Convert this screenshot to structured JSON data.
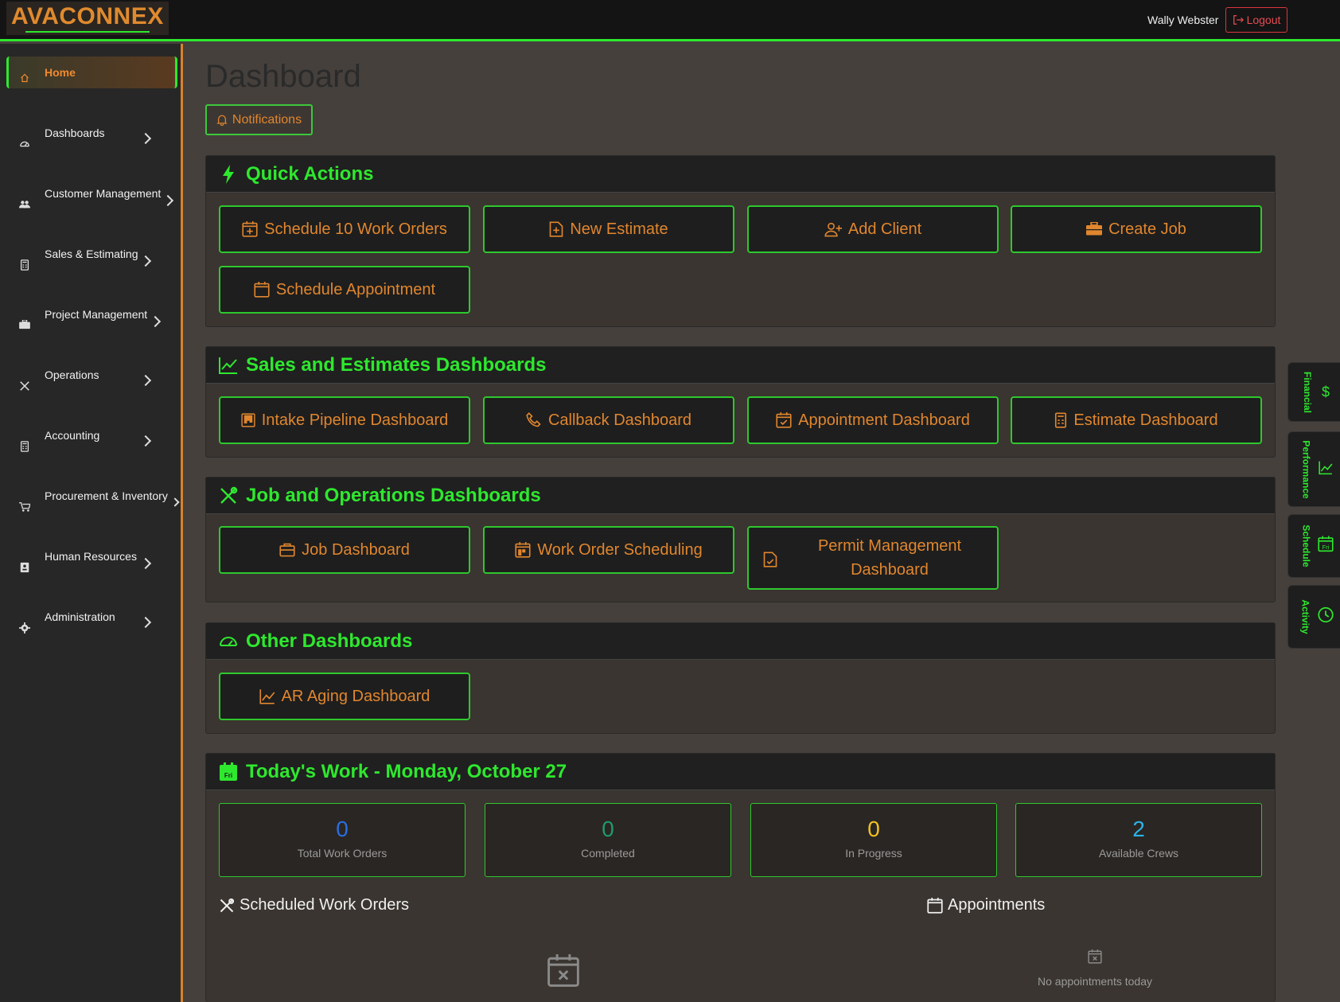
{
  "header": {
    "brand": "AVACONNEX",
    "user_name": "Wally Webster",
    "logout_label": "Logout"
  },
  "sidebar": {
    "items": [
      {
        "label": "Home",
        "icon": "home-icon",
        "active": true
      },
      {
        "label": "Dashboards",
        "icon": "gauge-icon"
      },
      {
        "label": "Customer Management",
        "icon": "people-icon"
      },
      {
        "label": "Sales & Estimating",
        "icon": "calculator-icon"
      },
      {
        "label": "Project Management",
        "icon": "briefcase-icon"
      },
      {
        "label": "Operations",
        "icon": "tools-icon"
      },
      {
        "label": "Accounting",
        "icon": "calculator-icon"
      },
      {
        "label": "Procurement & Inventory",
        "icon": "cart-icon"
      },
      {
        "label": "Human Resources",
        "icon": "badge-icon"
      },
      {
        "label": "Administration",
        "icon": "gear-icon"
      }
    ]
  },
  "main": {
    "title": "Dashboard",
    "notifications_label": "Notifications",
    "quick_actions": {
      "title": "Quick Actions",
      "buttons": [
        "Schedule 10 Work Orders",
        "New Estimate",
        "Add Client",
        "Create Job",
        "Schedule Appointment"
      ]
    },
    "sales_dashboards": {
      "title": "Sales and Estimates Dashboards",
      "buttons": [
        "Intake Pipeline Dashboard",
        "Callback Dashboard",
        "Appointment Dashboard",
        "Estimate Dashboard"
      ]
    },
    "job_dashboards": {
      "title": "Job and Operations Dashboards",
      "buttons": [
        "Job Dashboard",
        "Work Order Scheduling",
        "Permit Management Dashboard"
      ]
    },
    "other_dashboards": {
      "title": "Other Dashboards",
      "buttons": [
        "AR Aging Dashboard"
      ]
    },
    "todays_work": {
      "title": "Today's Work - Monday, October 27",
      "calendar_icon_text": "Fri",
      "stats": [
        {
          "value": "0",
          "label": "Total Work Orders",
          "color": "#2a6ee0"
        },
        {
          "value": "0",
          "label": "Completed",
          "color": "#1f9a6a"
        },
        {
          "value": "0",
          "label": "In Progress",
          "color": "#f0c020"
        },
        {
          "value": "2",
          "label": "Available Crews",
          "color": "#2ab4e8"
        }
      ],
      "scheduled_title": "Scheduled Work Orders",
      "appointments_title": "Appointments",
      "no_appointments": "No appointments today"
    }
  },
  "right_tabs": [
    {
      "label": "Financial",
      "icon": "dollar-icon"
    },
    {
      "label": "Performance",
      "icon": "chart-icon"
    },
    {
      "label": "Schedule",
      "icon": "calendar-icon",
      "icon_text": "Fri"
    },
    {
      "label": "Activity",
      "icon": "clock-icon"
    }
  ],
  "colors": {
    "accent_green": "#2ee82e",
    "accent_orange": "#e0862e",
    "logout_red": "#e84c53"
  }
}
